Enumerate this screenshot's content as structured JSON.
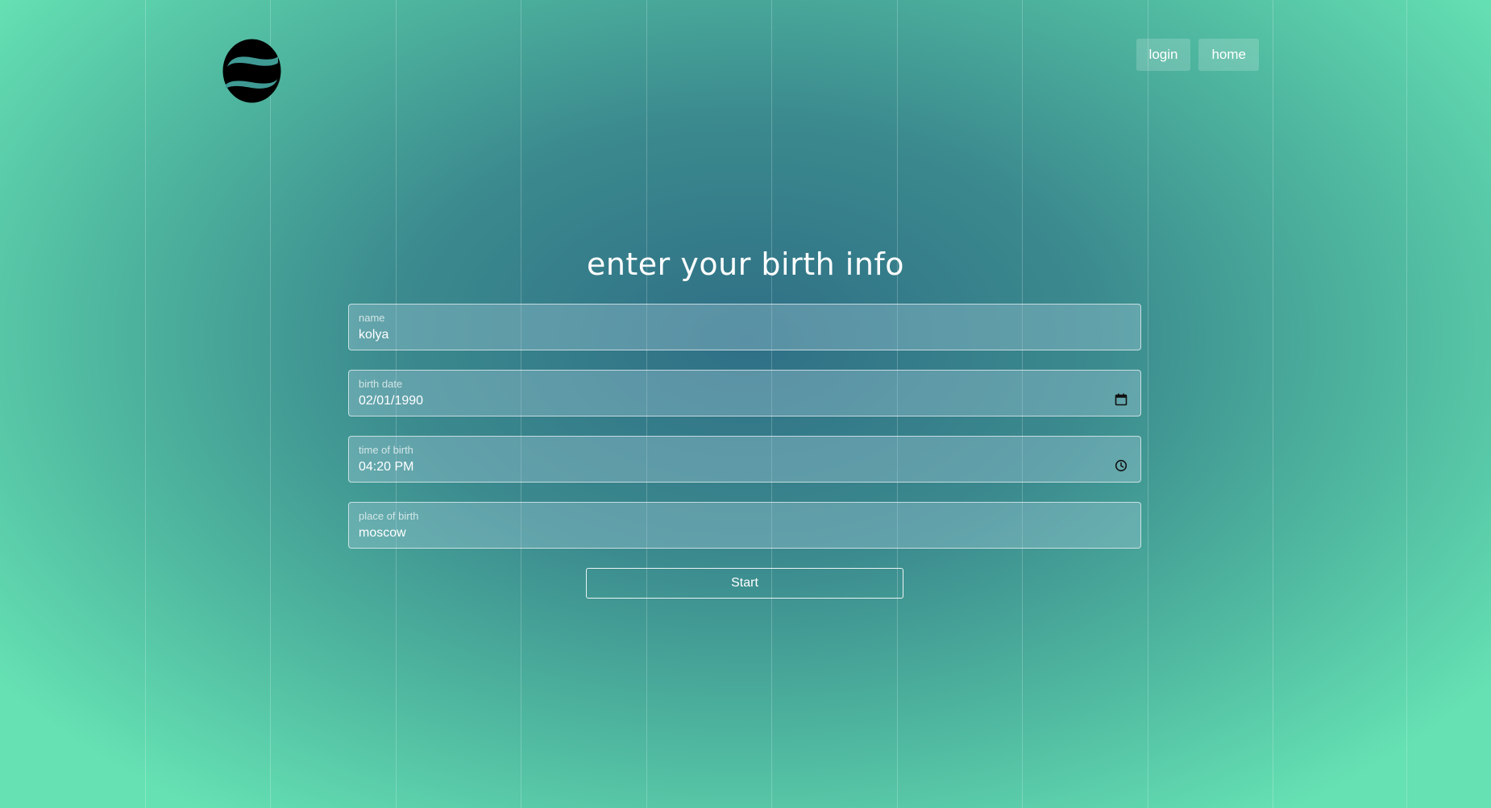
{
  "header": {
    "logo_icon": "brand-s-logo-icon",
    "nav": [
      {
        "label": "login"
      },
      {
        "label": "home"
      }
    ]
  },
  "page": {
    "title": "enter your birth info"
  },
  "form": {
    "name": {
      "label": "name",
      "value": "kolya"
    },
    "birth_date": {
      "label": "birth date",
      "value": "02/01/1990",
      "icon": "calendar-icon"
    },
    "time_of_birth": {
      "label": "time of birth",
      "value": "04:20 PM",
      "icon": "clock-icon"
    },
    "place_of_birth": {
      "label": "place of birth",
      "value": "moscow"
    },
    "submit_label": "Start"
  },
  "colors": {
    "background_center": "#2f6f86",
    "background_edge": "#65e1b3",
    "text": "#ffffff"
  }
}
